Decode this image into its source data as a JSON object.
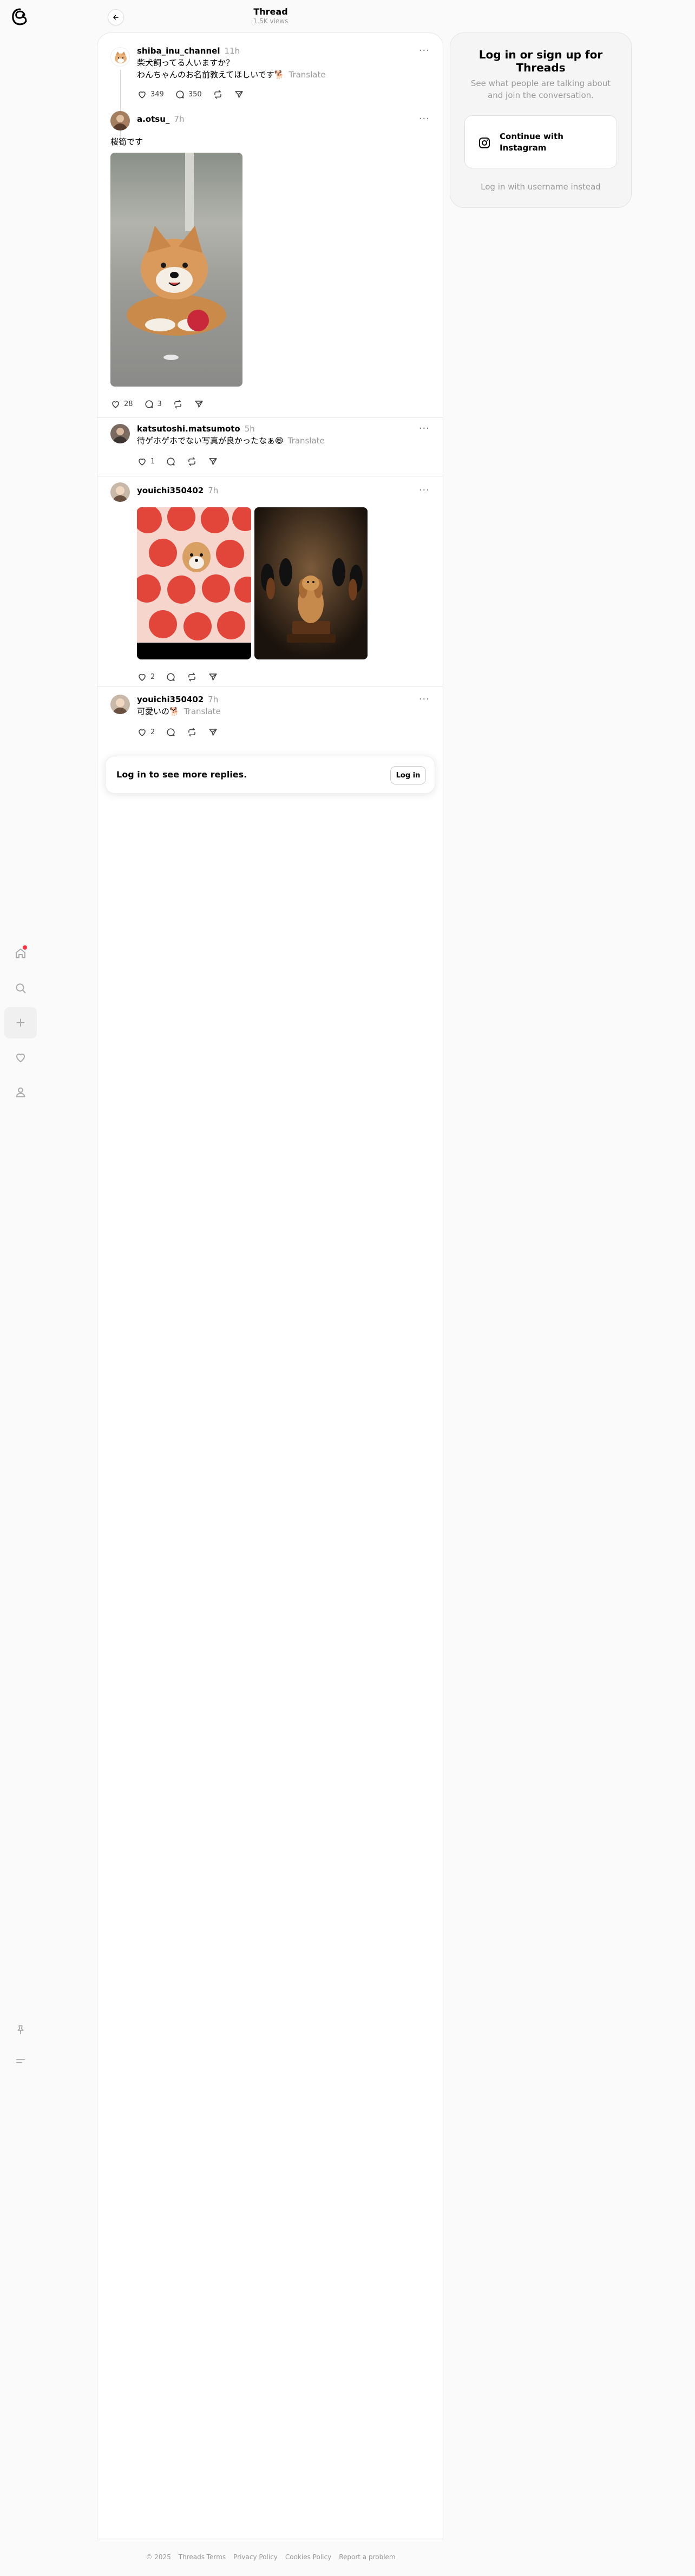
{
  "header": {
    "title": "Thread",
    "subtitle": "1.5K views"
  },
  "nav": [
    "home-icon",
    "search-icon",
    "create-icon",
    "heart-icon",
    "profile-icon",
    "pin-icon",
    "menu-icon"
  ],
  "posts": [
    {
      "username": "shiba_inu_channel",
      "time": "11h",
      "lines": [
        "柴犬飼ってる人いますか？",
        "わんちゃんのお名前教えてほしいです🐕"
      ],
      "translate": "Translate",
      "likes": "349",
      "replies": "350"
    },
    {
      "username": "a.otsu_",
      "time": "7h",
      "text": "桜筍です",
      "likes": "28",
      "replies": "3"
    },
    {
      "username": "katsutoshi.matsumoto",
      "time": "5h",
      "text": "待ゲホゲホでない写真が良かったなぁ😄",
      "translate": "Translate",
      "likes": "1"
    },
    {
      "username": "youichi350402",
      "time": "7h",
      "likes": "2"
    },
    {
      "username": "youichi350402",
      "time": "7h",
      "text": "可愛いの🐕",
      "translate": "Translate",
      "likes": "2"
    }
  ],
  "login_bar": {
    "text": "Log in to see more replies.",
    "button": "Log in"
  },
  "card": {
    "title": "Log in or sign up for Threads",
    "subtitle": "See what people are talking about and join the conversation.",
    "button": "Continue with Instagram",
    "alt": "Log in with username instead"
  },
  "footer": [
    "© 2025",
    "Threads Terms",
    "Privacy Policy",
    "Cookies Policy",
    "Report a problem"
  ],
  "colors": {
    "accent": "#000000",
    "muted": "#999999",
    "notification": "#ff3040"
  }
}
